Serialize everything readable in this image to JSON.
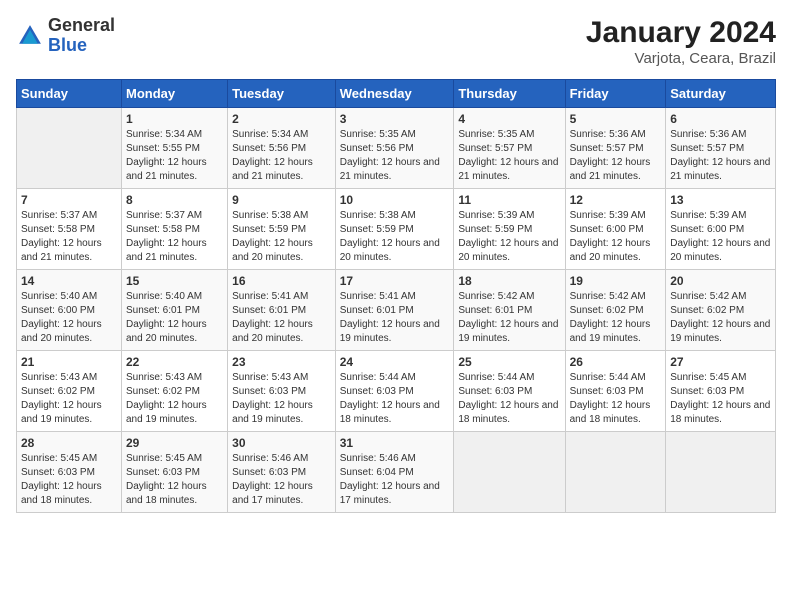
{
  "header": {
    "logo_general": "General",
    "logo_blue": "Blue",
    "title": "January 2024",
    "subtitle": "Varjota, Ceara, Brazil"
  },
  "columns": [
    "Sunday",
    "Monday",
    "Tuesday",
    "Wednesday",
    "Thursday",
    "Friday",
    "Saturday"
  ],
  "weeks": [
    [
      {
        "day": "",
        "sunrise": "",
        "sunset": "",
        "daylight": "",
        "empty": true
      },
      {
        "day": "1",
        "sunrise": "Sunrise: 5:34 AM",
        "sunset": "Sunset: 5:55 PM",
        "daylight": "Daylight: 12 hours and 21 minutes."
      },
      {
        "day": "2",
        "sunrise": "Sunrise: 5:34 AM",
        "sunset": "Sunset: 5:56 PM",
        "daylight": "Daylight: 12 hours and 21 minutes."
      },
      {
        "day": "3",
        "sunrise": "Sunrise: 5:35 AM",
        "sunset": "Sunset: 5:56 PM",
        "daylight": "Daylight: 12 hours and 21 minutes."
      },
      {
        "day": "4",
        "sunrise": "Sunrise: 5:35 AM",
        "sunset": "Sunset: 5:57 PM",
        "daylight": "Daylight: 12 hours and 21 minutes."
      },
      {
        "day": "5",
        "sunrise": "Sunrise: 5:36 AM",
        "sunset": "Sunset: 5:57 PM",
        "daylight": "Daylight: 12 hours and 21 minutes."
      },
      {
        "day": "6",
        "sunrise": "Sunrise: 5:36 AM",
        "sunset": "Sunset: 5:57 PM",
        "daylight": "Daylight: 12 hours and 21 minutes."
      }
    ],
    [
      {
        "day": "7",
        "sunrise": "Sunrise: 5:37 AM",
        "sunset": "Sunset: 5:58 PM",
        "daylight": "Daylight: 12 hours and 21 minutes."
      },
      {
        "day": "8",
        "sunrise": "Sunrise: 5:37 AM",
        "sunset": "Sunset: 5:58 PM",
        "daylight": "Daylight: 12 hours and 21 minutes."
      },
      {
        "day": "9",
        "sunrise": "Sunrise: 5:38 AM",
        "sunset": "Sunset: 5:59 PM",
        "daylight": "Daylight: 12 hours and 20 minutes."
      },
      {
        "day": "10",
        "sunrise": "Sunrise: 5:38 AM",
        "sunset": "Sunset: 5:59 PM",
        "daylight": "Daylight: 12 hours and 20 minutes."
      },
      {
        "day": "11",
        "sunrise": "Sunrise: 5:39 AM",
        "sunset": "Sunset: 5:59 PM",
        "daylight": "Daylight: 12 hours and 20 minutes."
      },
      {
        "day": "12",
        "sunrise": "Sunrise: 5:39 AM",
        "sunset": "Sunset: 6:00 PM",
        "daylight": "Daylight: 12 hours and 20 minutes."
      },
      {
        "day": "13",
        "sunrise": "Sunrise: 5:39 AM",
        "sunset": "Sunset: 6:00 PM",
        "daylight": "Daylight: 12 hours and 20 minutes."
      }
    ],
    [
      {
        "day": "14",
        "sunrise": "Sunrise: 5:40 AM",
        "sunset": "Sunset: 6:00 PM",
        "daylight": "Daylight: 12 hours and 20 minutes."
      },
      {
        "day": "15",
        "sunrise": "Sunrise: 5:40 AM",
        "sunset": "Sunset: 6:01 PM",
        "daylight": "Daylight: 12 hours and 20 minutes."
      },
      {
        "day": "16",
        "sunrise": "Sunrise: 5:41 AM",
        "sunset": "Sunset: 6:01 PM",
        "daylight": "Daylight: 12 hours and 20 minutes."
      },
      {
        "day": "17",
        "sunrise": "Sunrise: 5:41 AM",
        "sunset": "Sunset: 6:01 PM",
        "daylight": "Daylight: 12 hours and 19 minutes."
      },
      {
        "day": "18",
        "sunrise": "Sunrise: 5:42 AM",
        "sunset": "Sunset: 6:01 PM",
        "daylight": "Daylight: 12 hours and 19 minutes."
      },
      {
        "day": "19",
        "sunrise": "Sunrise: 5:42 AM",
        "sunset": "Sunset: 6:02 PM",
        "daylight": "Daylight: 12 hours and 19 minutes."
      },
      {
        "day": "20",
        "sunrise": "Sunrise: 5:42 AM",
        "sunset": "Sunset: 6:02 PM",
        "daylight": "Daylight: 12 hours and 19 minutes."
      }
    ],
    [
      {
        "day": "21",
        "sunrise": "Sunrise: 5:43 AM",
        "sunset": "Sunset: 6:02 PM",
        "daylight": "Daylight: 12 hours and 19 minutes."
      },
      {
        "day": "22",
        "sunrise": "Sunrise: 5:43 AM",
        "sunset": "Sunset: 6:02 PM",
        "daylight": "Daylight: 12 hours and 19 minutes."
      },
      {
        "day": "23",
        "sunrise": "Sunrise: 5:43 AM",
        "sunset": "Sunset: 6:03 PM",
        "daylight": "Daylight: 12 hours and 19 minutes."
      },
      {
        "day": "24",
        "sunrise": "Sunrise: 5:44 AM",
        "sunset": "Sunset: 6:03 PM",
        "daylight": "Daylight: 12 hours and 18 minutes."
      },
      {
        "day": "25",
        "sunrise": "Sunrise: 5:44 AM",
        "sunset": "Sunset: 6:03 PM",
        "daylight": "Daylight: 12 hours and 18 minutes."
      },
      {
        "day": "26",
        "sunrise": "Sunrise: 5:44 AM",
        "sunset": "Sunset: 6:03 PM",
        "daylight": "Daylight: 12 hours and 18 minutes."
      },
      {
        "day": "27",
        "sunrise": "Sunrise: 5:45 AM",
        "sunset": "Sunset: 6:03 PM",
        "daylight": "Daylight: 12 hours and 18 minutes."
      }
    ],
    [
      {
        "day": "28",
        "sunrise": "Sunrise: 5:45 AM",
        "sunset": "Sunset: 6:03 PM",
        "daylight": "Daylight: 12 hours and 18 minutes."
      },
      {
        "day": "29",
        "sunrise": "Sunrise: 5:45 AM",
        "sunset": "Sunset: 6:03 PM",
        "daylight": "Daylight: 12 hours and 18 minutes."
      },
      {
        "day": "30",
        "sunrise": "Sunrise: 5:46 AM",
        "sunset": "Sunset: 6:03 PM",
        "daylight": "Daylight: 12 hours and 17 minutes."
      },
      {
        "day": "31",
        "sunrise": "Sunrise: 5:46 AM",
        "sunset": "Sunset: 6:04 PM",
        "daylight": "Daylight: 12 hours and 17 minutes."
      },
      {
        "day": "",
        "sunrise": "",
        "sunset": "",
        "daylight": "",
        "empty": true
      },
      {
        "day": "",
        "sunrise": "",
        "sunset": "",
        "daylight": "",
        "empty": true
      },
      {
        "day": "",
        "sunrise": "",
        "sunset": "",
        "daylight": "",
        "empty": true
      }
    ]
  ]
}
